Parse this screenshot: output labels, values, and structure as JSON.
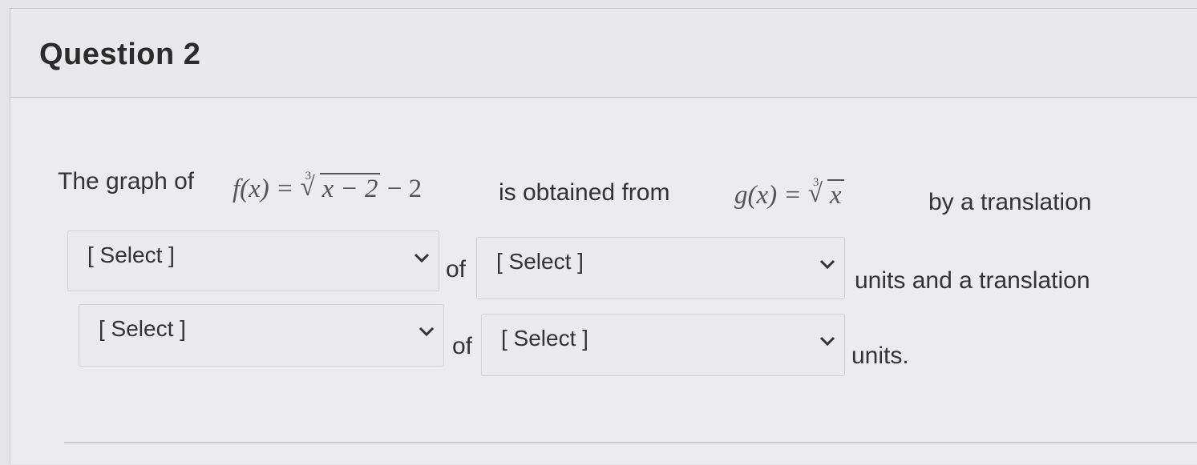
{
  "question": {
    "title": "Question 2",
    "prompt_start": "The graph of",
    "f_label": "f(x) = ",
    "f_radicand": "x − 2",
    "f_tail": " − 2",
    "middle_text": "is obtained from",
    "g_label": "g(x) = ",
    "g_radicand": "x",
    "end_text": "by a translation",
    "root_index": "3",
    "root_symbol": "√"
  },
  "rows": [
    {
      "first_select": "[ Select ]",
      "connector": "of",
      "second_select": "[ Select ]",
      "trailing": "units and a translation"
    },
    {
      "first_select": "[ Select ]",
      "connector": "of",
      "second_select": "[ Select ]",
      "trailing": "units."
    }
  ],
  "icons": {
    "dropdown": "chevron-down-icon"
  }
}
